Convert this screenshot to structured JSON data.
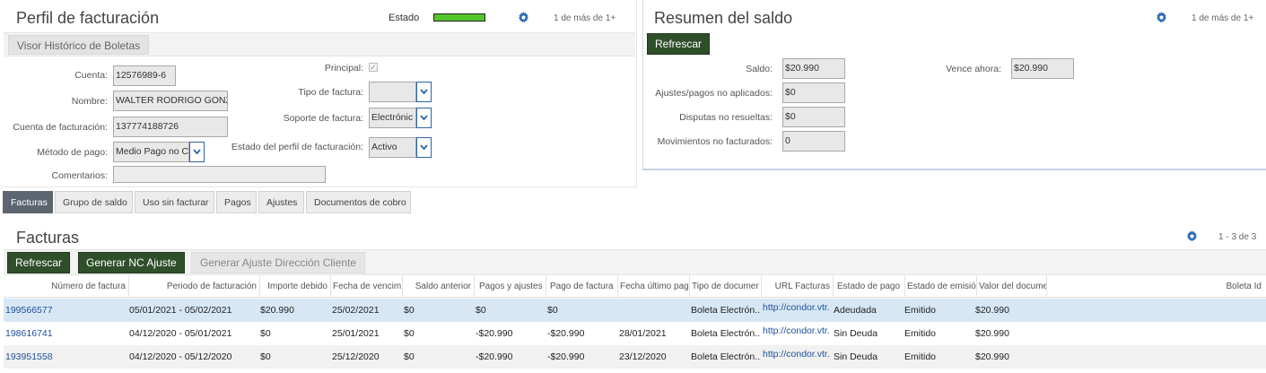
{
  "perfil": {
    "title": "Perfil de facturación",
    "estado_label": "Estado",
    "estado_color": "#55c52c",
    "pager": "1 de más de 1+",
    "subtab": "Visor Histórico de Boletas",
    "fields": {
      "cuenta_label": "Cuenta:",
      "cuenta_value": "12576989-6",
      "nombre_label": "Nombre:",
      "nombre_value": "WALTER RODRIGO GONZA",
      "cuenta_fact_label": "Cuenta de facturación:",
      "cuenta_fact_value": "137774188726",
      "metodo_label": "Método de pago:",
      "metodo_value": "Medio Pago no C",
      "comentarios_label": "Comentarios:",
      "principal_label": "Principal:",
      "principal_check": "✓",
      "tipo_label": "Tipo de factura:",
      "tipo_value": "",
      "soporte_label": "Soporte de factura:",
      "soporte_value": "Electrónic",
      "estado_perfil_label": "Estado del perfil de facturación:",
      "estado_perfil_value": "Activo"
    }
  },
  "resumen": {
    "title": "Resumen del saldo",
    "pager": "1 de más de 1+",
    "refresh": "Refrescar",
    "saldo_label": "Saldo:",
    "saldo_value": "$20.990",
    "vence_label": "Vence ahora:",
    "vence_value": "$20.990",
    "ajustes_label": "Ajustes/pagos no aplicados:",
    "ajustes_value": "$0",
    "disputas_label": "Disputas no resueltas:",
    "disputas_value": "$0",
    "movimientos_label": "Movimientos no facturados:",
    "movimientos_value": "0"
  },
  "tabs": [
    "Facturas",
    "Grupo de saldo",
    "Uso sin facturar",
    "Pagos",
    "Ajustes",
    "Documentos de cobro"
  ],
  "facturas": {
    "title": "Facturas",
    "pager": "1 - 3 de 3",
    "btn_refresh": "Refrescar",
    "btn_nc": "Generar NC Ajuste",
    "btn_dir": "Generar Ajuste Dirección Cliente",
    "columns": [
      "Número de factura",
      "Periodo de facturación",
      "Importe debido",
      "Fecha de vencim",
      "Saldo anterior",
      "Pagos y ajustes",
      "Pago de factura",
      "Fecha último pag",
      "Tipo de documer",
      "URL Facturas",
      "Estado de pago",
      "Estado de emisió",
      "Valor del docume",
      "Boleta Id"
    ],
    "rows": [
      [
        "199566577",
        "05/01/2021 - 05/02/2021",
        "$20.990",
        "25/02/2021",
        "$0",
        "$0",
        "$0",
        "",
        "Boleta Electrón...",
        "http://condor.vtr.",
        "Adeudada",
        "Emitido",
        "$20.990",
        ""
      ],
      [
        "198616741",
        "04/12/2020 - 05/01/2021",
        "$0",
        "25/01/2021",
        "$0",
        "-$20.990",
        "-$20.990",
        "28/01/2021",
        "Boleta Electrón...",
        "http://condor.vtr.",
        "Sin Deuda",
        "Emitido",
        "$20.990",
        ""
      ],
      [
        "193951558",
        "04/12/2020 - 05/12/2020",
        "$0",
        "25/12/2020",
        "$0",
        "-$20.990",
        "-$20.990",
        "23/12/2020",
        "Boleta Electrón...",
        "http://condor.vtr.",
        "Sin Deuda",
        "Emitido",
        "$20.990",
        ""
      ]
    ]
  },
  "colors": {
    "accent_dark_green": "#2f4f2a",
    "gear_blue": "#2b6cb0",
    "selected_row": "#d7e8f4",
    "link": "#1f4f99"
  }
}
